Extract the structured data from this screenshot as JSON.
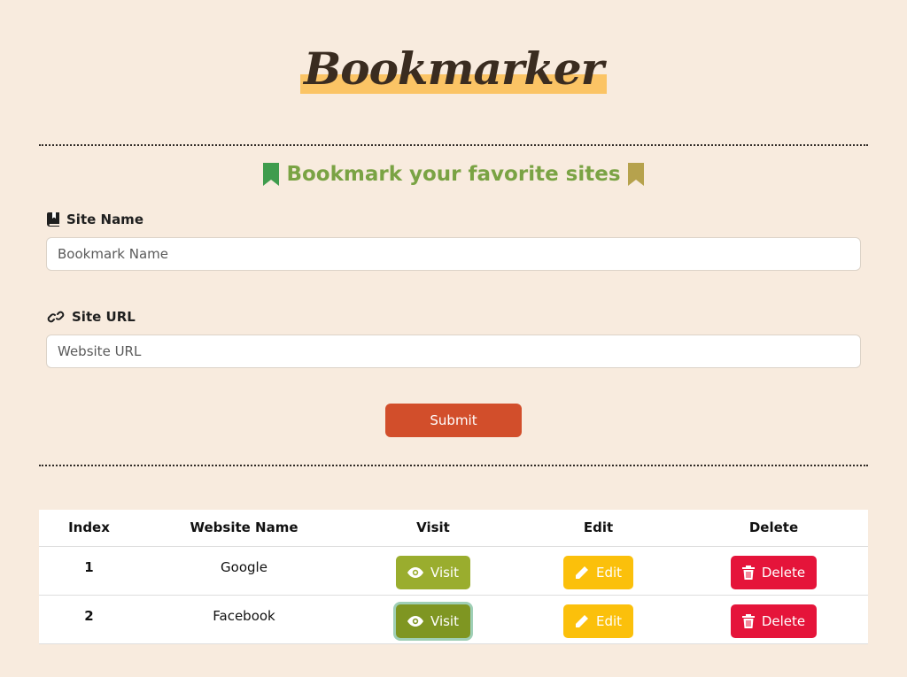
{
  "app": {
    "logo": "Bookmarker",
    "tagline": "Bookmark your favorite sites"
  },
  "form": {
    "site_name": {
      "label": "Site Name",
      "placeholder": "Bookmark Name"
    },
    "site_url": {
      "label": "Site URL",
      "placeholder": "Website URL"
    },
    "submit_label": "Submit"
  },
  "table": {
    "headers": {
      "index": "Index",
      "name": "Website Name",
      "visit": "Visit",
      "edit": "Edit",
      "delete": "Delete"
    },
    "rows": [
      {
        "index": "1",
        "name": "Google",
        "visit": "Visit",
        "edit": "Edit",
        "delete": "Delete"
      },
      {
        "index": "2",
        "name": "Facebook",
        "visit": "Visit",
        "edit": "Edit",
        "delete": "Delete"
      }
    ]
  },
  "colors": {
    "background": "#f8ebde",
    "submit": "#d24e2b",
    "visit": "#9aad2e",
    "edit": "#fbc00b",
    "delete": "#e5143a",
    "tagline": "#7aa344"
  },
  "icons": [
    "bookmark-icon",
    "book-icon",
    "link-icon",
    "eye-icon",
    "pencil-icon",
    "trash-icon"
  ]
}
